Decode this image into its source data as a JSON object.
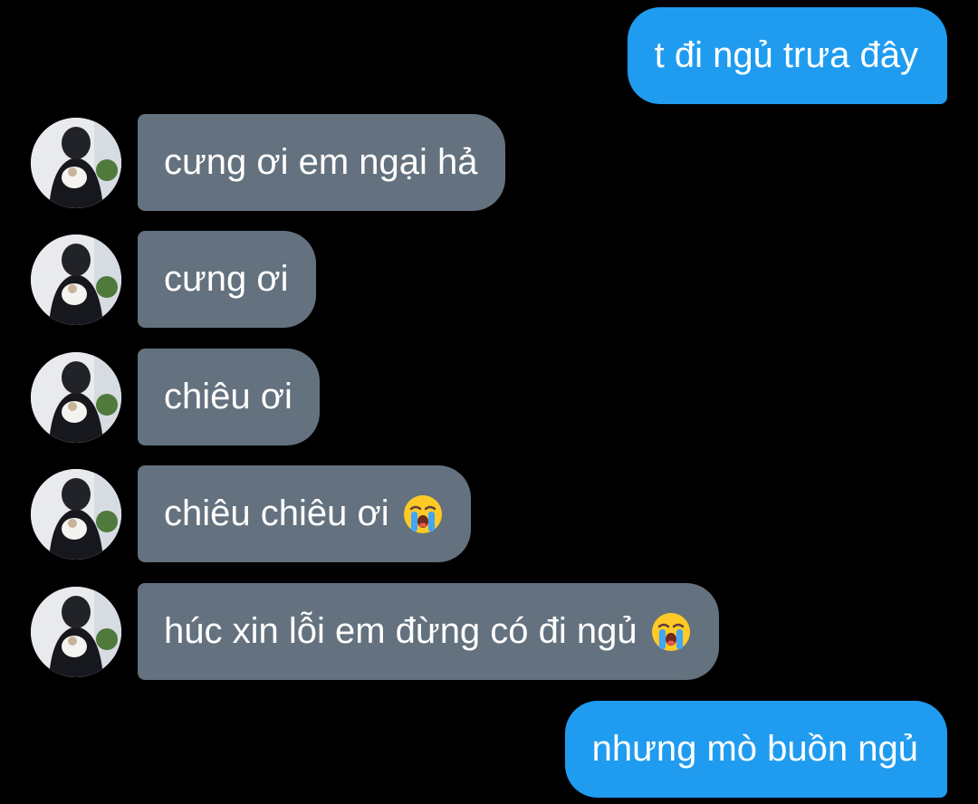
{
  "messages": [
    {
      "side": "sent",
      "text": "t đi ngủ trưa đây"
    },
    {
      "side": "received",
      "text": "cưng ơi em ngại hả"
    },
    {
      "side": "received",
      "text": "cưng ơi"
    },
    {
      "side": "received",
      "text": "chiêu ơi"
    },
    {
      "side": "received",
      "text": "chiêu chiêu ơi",
      "emoji": "loudly-crying-face-icon"
    },
    {
      "side": "received",
      "text": "húc xin lỗi em đừng có đi ngủ",
      "emoji": "loudly-crying-face-icon"
    },
    {
      "side": "sent",
      "text": "nhưng mò buồn ngủ"
    }
  ],
  "colors": {
    "background": "#000000",
    "sent_bubble": "#1f9cf0",
    "received_bubble": "#64717e",
    "text": "#ffffff"
  },
  "icons": {
    "avatar": "contact-avatar-icon",
    "emoji": "loudly-crying-face-icon"
  }
}
